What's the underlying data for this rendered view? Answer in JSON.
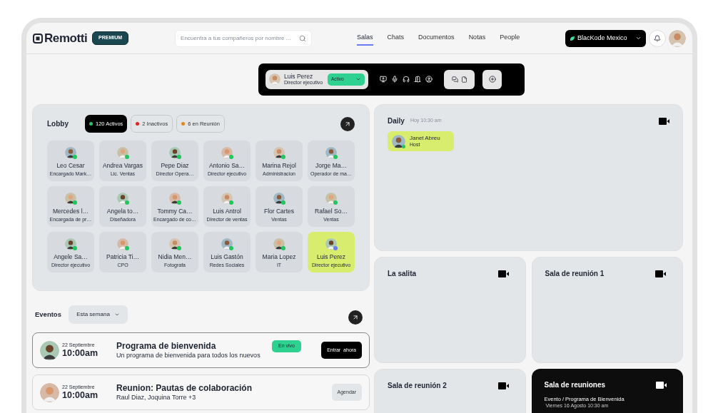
{
  "header": {
    "logo": "Remotti",
    "plan_badge": "PREMIUM",
    "search": {
      "placeholder": "Encuentra a tus compañeros por nombre ..."
    },
    "nav": [
      {
        "label": "Salas",
        "selected": true
      },
      {
        "label": "Chats",
        "selected": false
      },
      {
        "label": "Documentos",
        "selected": false
      },
      {
        "label": "Notas",
        "selected": false
      },
      {
        "label": "People",
        "selected": false
      }
    ],
    "workspace": "BlacKode Mexico"
  },
  "control_bar": {
    "user": {
      "name": "Luis Perez",
      "role": "Director ejecutivo"
    },
    "status": "Activo"
  },
  "lobby": {
    "title": "Lobby",
    "filters": [
      {
        "label": "120 Activos",
        "color": "#22c55e",
        "selected": true
      },
      {
        "label": "2 Inactivos",
        "color": "#dc2626",
        "selected": false
      },
      {
        "label": "6 en Reunión",
        "color": "#e08a1e",
        "selected": false
      }
    ],
    "people": [
      {
        "name": "Leo Cesar",
        "role": "Encargado Mark…",
        "color": "#22c55e",
        "selected": false
      },
      {
        "name": "Andrea Vargas",
        "role": "Lic. Ventas",
        "color": "#22c55e",
        "selected": false
      },
      {
        "name": "Pepe Diaz",
        "role": "Director Opera…",
        "color": "#22c55e",
        "selected": false
      },
      {
        "name": "Antonio Sa…",
        "role": "Director ejecutivo",
        "color": "#22c55e",
        "selected": false
      },
      {
        "name": "Marina Rejol",
        "role": "Administracion",
        "color": "#22c55e",
        "selected": false
      },
      {
        "name": "Jorge Ma…",
        "role": "Operador de ma…",
        "color": "#22c55e",
        "selected": false
      },
      {
        "name": "Mercedes l…",
        "role": "Encargada de pr…",
        "color": "#22c55e",
        "selected": false
      },
      {
        "name": "Angela to…",
        "role": "Diseñadora",
        "color": "#22c55e",
        "selected": false
      },
      {
        "name": "Tommy Ca…",
        "role": "Encargado de co…",
        "color": "#22c55e",
        "selected": false
      },
      {
        "name": "Luis Antrol",
        "role": "Director de ventas",
        "color": "#22c55e",
        "selected": false
      },
      {
        "name": "Flor Cartes",
        "role": "Ventas",
        "color": "#22c55e",
        "selected": false
      },
      {
        "name": "Rafael So…",
        "role": "Ventas",
        "color": "#22c55e",
        "selected": false
      },
      {
        "name": "Angele Sa…",
        "role": "Director ejecutivo",
        "color": "#22c55e",
        "selected": false
      },
      {
        "name": "Patricia Ti…",
        "role": "CPO",
        "color": "#22c55e",
        "selected": false
      },
      {
        "name": "Nidia Men…",
        "role": "Fotografa",
        "color": "#22c55e",
        "selected": false
      },
      {
        "name": "Luis Gastón",
        "role": "Redes Sociales",
        "color": "#22c55e",
        "selected": false
      },
      {
        "name": "Maria Lopez",
        "role": "IT",
        "color": "#22c55e",
        "selected": false
      },
      {
        "name": "Luis Perez",
        "role": "Director ejecutivo",
        "color": "#6b7cf0",
        "selected": true
      }
    ]
  },
  "events": {
    "title": "Eventos",
    "filter": "Esta semana",
    "items": [
      {
        "date": "22 Septiembre",
        "time": "10:00am",
        "title": "Programa de bienvenida",
        "subtitle": "Un programa de bienvenida para todos los nuevos",
        "badge": "En vivo",
        "action": "Entrar  ahora",
        "kind": "live"
      },
      {
        "date": "22 Septiembre",
        "time": "10:00am",
        "title": "Reunion: Pautas de colaboración",
        "subtitle": "Raul Diaz, Joquina Torre +3",
        "action": "Agendar",
        "kind": "scheduled"
      }
    ]
  },
  "daily": {
    "title": "Daily",
    "time": "Hoy 10:30 am",
    "participants": [
      {
        "name": "Janet Abreu",
        "role": "Host",
        "color": "#22c55e"
      }
    ]
  },
  "rooms": [
    {
      "name": "La salita",
      "selected": false
    },
    {
      "name": "Sala de reunión 1",
      "selected": false
    },
    {
      "name": "Sala de reunión 2",
      "selected": false
    },
    {
      "name": "Sala de reuniones",
      "selected": true,
      "event": "Evento / Programa de Bienvenida",
      "when": "Viernes 16 Agosto 10:30 am"
    }
  ]
}
